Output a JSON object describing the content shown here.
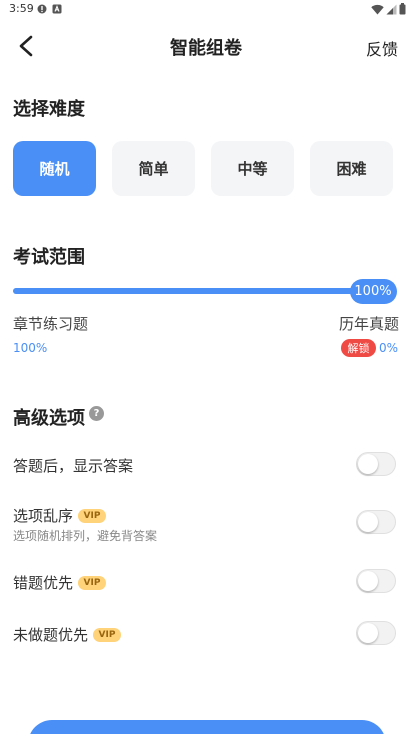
{
  "status_bar": {
    "time": "3:59"
  },
  "header": {
    "title": "智能组卷",
    "feedback_label": "反馈"
  },
  "difficulty": {
    "title": "选择难度",
    "options": [
      {
        "label": "随机",
        "selected": true
      },
      {
        "label": "简单",
        "selected": false
      },
      {
        "label": "中等",
        "selected": false
      },
      {
        "label": "困难",
        "selected": false
      }
    ]
  },
  "scope": {
    "title": "考试范围",
    "slider_percent": 100,
    "slider_label": "100%",
    "left_label": "章节练习题",
    "left_value": "100%",
    "right_label": "历年真题",
    "right_value": "0%",
    "unlock_label": "解锁"
  },
  "advanced": {
    "title": "高级选项",
    "help_glyph": "?",
    "vip_label": "VIP",
    "options": [
      {
        "label": "答题后，显示答案",
        "vip": false,
        "enabled": false
      },
      {
        "label": "选项乱序",
        "vip": true,
        "subtitle": "选项随机排列，避免背答案",
        "enabled": false
      },
      {
        "label": "错题优先",
        "vip": true,
        "enabled": false
      },
      {
        "label": "未做题优先",
        "vip": true,
        "enabled": false
      }
    ]
  },
  "colors": {
    "accent": "#4a8ff5",
    "danger": "#f04a45",
    "vip_bg": "#ffd37a",
    "track": "#e6ebf3"
  }
}
